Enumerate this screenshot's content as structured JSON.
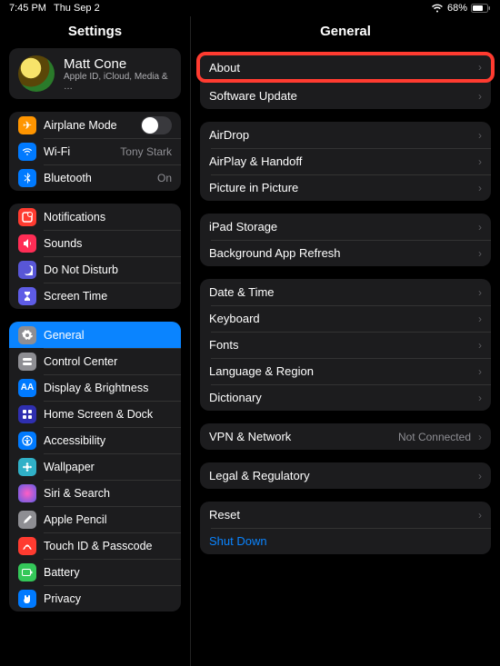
{
  "status": {
    "time": "7:45 PM",
    "date": "Thu Sep 2",
    "battery": "68%"
  },
  "sidebar": {
    "title": "Settings",
    "profile": {
      "name": "Matt Cone",
      "subtitle": "Apple ID, iCloud, Media & …"
    },
    "airplane": {
      "label": "Airplane Mode"
    },
    "wifi": {
      "label": "Wi-Fi",
      "value": "Tony Stark"
    },
    "bluetooth": {
      "label": "Bluetooth",
      "value": "On"
    },
    "notifications": {
      "label": "Notifications"
    },
    "sounds": {
      "label": "Sounds"
    },
    "dnd": {
      "label": "Do Not Disturb"
    },
    "screentime": {
      "label": "Screen Time"
    },
    "general": {
      "label": "General"
    },
    "controlcenter": {
      "label": "Control Center"
    },
    "display": {
      "label": "Display & Brightness"
    },
    "homescreen": {
      "label": "Home Screen & Dock"
    },
    "accessibility": {
      "label": "Accessibility"
    },
    "wallpaper": {
      "label": "Wallpaper"
    },
    "siri": {
      "label": "Siri & Search"
    },
    "pencil": {
      "label": "Apple Pencil"
    },
    "touchid": {
      "label": "Touch ID & Passcode"
    },
    "battery": {
      "label": "Battery"
    },
    "privacy": {
      "label": "Privacy"
    }
  },
  "detail": {
    "title": "General",
    "about": {
      "label": "About"
    },
    "software": {
      "label": "Software Update"
    },
    "airdrop": {
      "label": "AirDrop"
    },
    "airplay": {
      "label": "AirPlay & Handoff"
    },
    "pip": {
      "label": "Picture in Picture"
    },
    "storage": {
      "label": "iPad Storage"
    },
    "bgapp": {
      "label": "Background App Refresh"
    },
    "datetime": {
      "label": "Date & Time"
    },
    "keyboard": {
      "label": "Keyboard"
    },
    "fonts": {
      "label": "Fonts"
    },
    "language": {
      "label": "Language & Region"
    },
    "dictionary": {
      "label": "Dictionary"
    },
    "vpn": {
      "label": "VPN & Network",
      "value": "Not Connected"
    },
    "legal": {
      "label": "Legal & Regulatory"
    },
    "reset": {
      "label": "Reset"
    },
    "shutdown": {
      "label": "Shut Down"
    }
  }
}
